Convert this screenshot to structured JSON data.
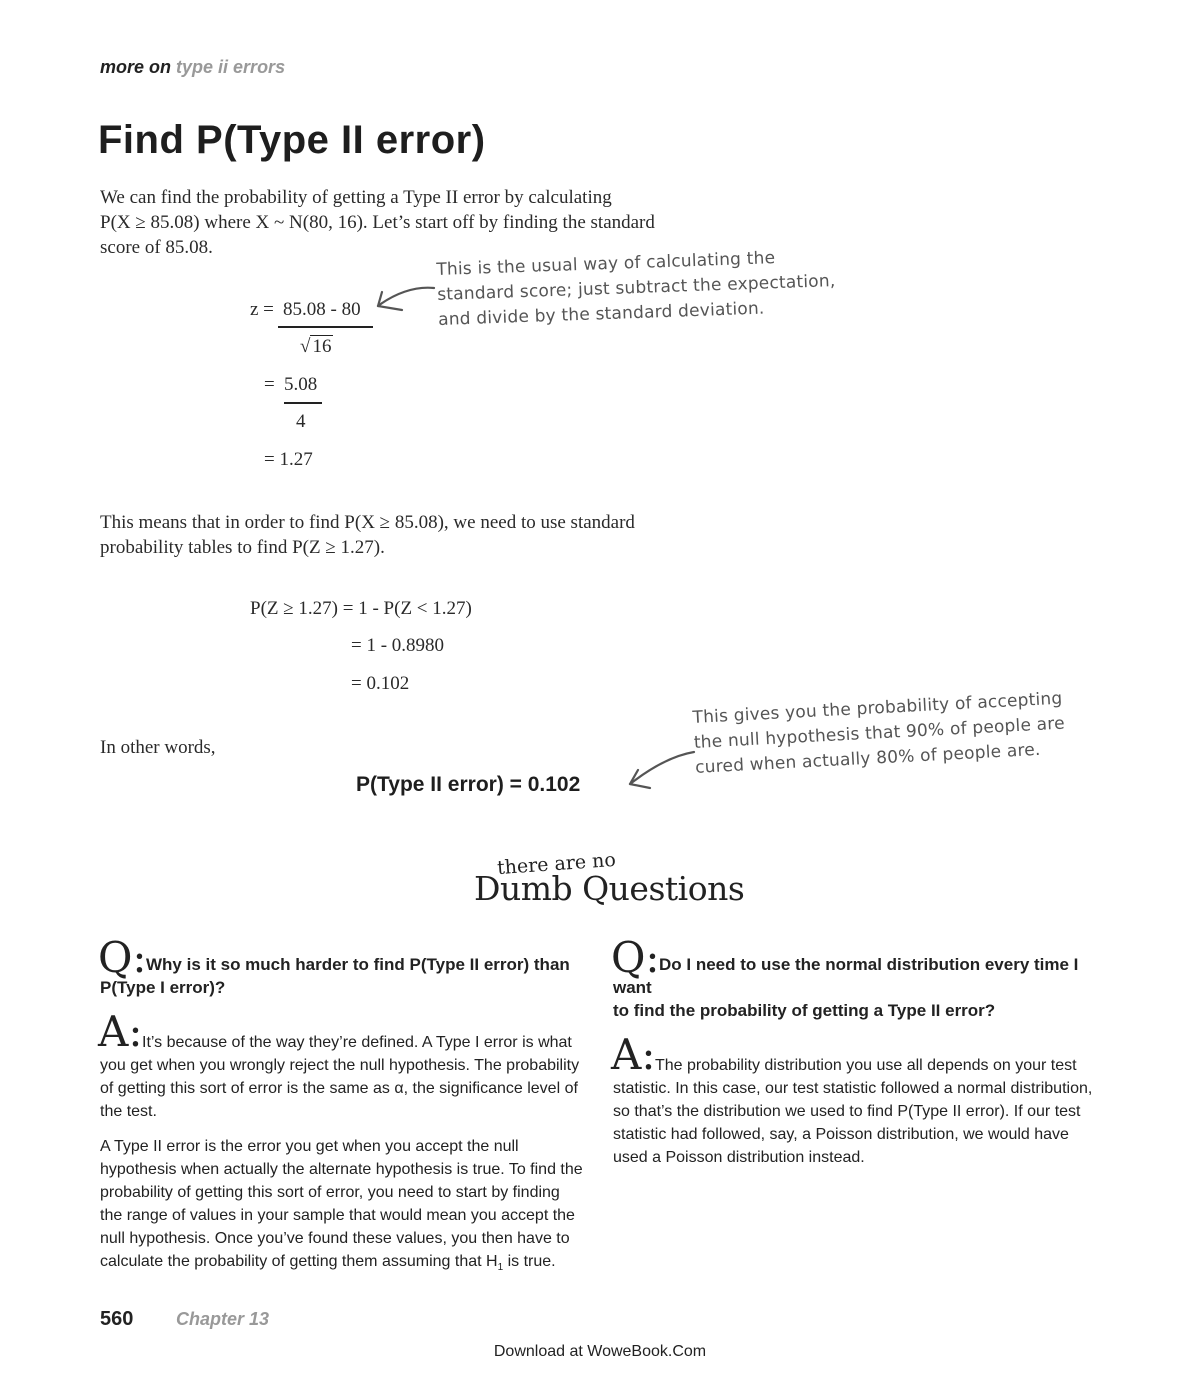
{
  "header": {
    "prefix": "more on",
    "topic": "type ii errors"
  },
  "title": "Find P(Type II error)",
  "intro": {
    "line1": "We can find the probability of getting a Type II error by calculating",
    "line2": "P(X ≥ 85.08) where X ~ N(80, 16). Let’s start off by finding the standard",
    "line3": "score of 85.08."
  },
  "zcalc": {
    "z_prefix": "z =",
    "num1": "85.08 - 80",
    "den1_root": "√",
    "den1": "16",
    "eq2_prefix": "=",
    "num2": "5.08",
    "den2": "4",
    "eq3": "= 1.27"
  },
  "annotation1": {
    "line1": "This is the usual way of calculating the",
    "line2": "standard score; just subtract the expectation,",
    "line3": "and divide by the standard deviation."
  },
  "means": {
    "line1": "This means that in order to find P(X ≥ 85.08), we need to use standard",
    "line2": "probability tables to find P(Z ≥ 1.27)."
  },
  "pcalc": {
    "line1": "P(Z ≥ 1.27) = 1 - P(Z < 1.27)",
    "line2": "= 1 - 0.8980",
    "line3": "= 0.102"
  },
  "other_words": "In other words,",
  "result": "P(Type II error) = 0.102",
  "annotation2": {
    "line1": "This gives you the probability of accepting",
    "line2": "the null hypothesis that 90% of people are",
    "line3": "cured when actually 80% of people are."
  },
  "dumb_questions": {
    "small": "there are no",
    "big": "Dumb Questions"
  },
  "qa_left": {
    "q_mark": "Q:",
    "q_line1": "Why is it so much harder to find P(Type II error) than",
    "q_line2": "P(Type I error)?",
    "a_mark": "A:",
    "a_p1_line1": "It’s because of the way they’re defined. A Type I error is what",
    "a_p1_line2": "you get when you wrongly reject the null hypothesis. The probability",
    "a_p1_line3": "of getting this sort of error is the same as α, the significance level of",
    "a_p1_line4": "the test.",
    "a_p2_line1": "A Type II error is the error you get when you accept the null",
    "a_p2_line2": "hypothesis when actually the alternate hypothesis is true. To find the",
    "a_p2_line3": "probability of getting this sort of error, you need to start by finding",
    "a_p2_line4": "the range of values in your sample that would mean you accept the",
    "a_p2_line5": "null hypothesis. Once you’ve found these values, you then have to",
    "a_p2_line6_pre": "calculate the probability of getting them assuming that H",
    "a_p2_line6_sub": "1",
    "a_p2_line6_post": " is true."
  },
  "qa_right": {
    "q_mark": "Q:",
    "q_line1": "Do I need to use the normal distribution every time I want",
    "q_line2": "to find the probability of getting a Type II error?",
    "a_mark": "A:",
    "a_line1": "The probability distribution you use all depends on your test",
    "a_line2": "statistic. In this case, our test statistic followed a normal distribution,",
    "a_line3": "so that’s the distribution we used to find P(Type II error). If our test",
    "a_line4": "statistic had followed, say, a Poisson distribution, we would have",
    "a_line5": "used a Poisson distribution instead."
  },
  "footer": {
    "page_number": "560",
    "chapter": "Chapter 13",
    "download": "Download at WoweBook.Com"
  }
}
